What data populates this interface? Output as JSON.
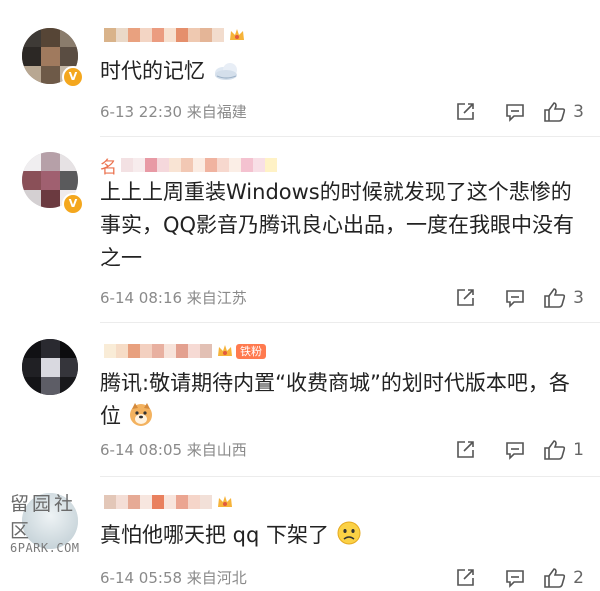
{
  "comments": [
    {
      "username_prefix": "",
      "text": "时代的记忆",
      "emoji": "cloud-emoji",
      "meta": "6-13 22:30 来自福建",
      "likes": "3",
      "verified": true,
      "fan_badge": ""
    },
    {
      "username_prefix": "名",
      "text": "上上上周重装Windows的时候就发现了这个悲惨的事实，QQ影音乃腾讯良心出品，一度在我眼中没有之一",
      "emoji": "",
      "meta": "6-14 08:16 来自江苏",
      "likes": "3",
      "verified": true,
      "fan_badge": ""
    },
    {
      "username_prefix": "",
      "text": "腾讯:敬请期待内置“收费商城”的划时代版本吧，各位",
      "emoji": "dog-emoji",
      "meta": "6-14 08:05 来自山西",
      "likes": "1",
      "verified": false,
      "fan_badge": "铁粉"
    },
    {
      "username_prefix": "",
      "text": "真怕他哪天把 qq 下架了",
      "emoji": "worried-face-emoji",
      "meta": "6-14 05:58 来自河北",
      "likes": "2",
      "verified": false,
      "fan_badge": ""
    }
  ],
  "watermark": {
    "cn": "留园社区",
    "en": "6PARK.COM"
  },
  "colors": {
    "username": "#eb7350",
    "meta": "#8a8a8a",
    "verified": "#f4a71e",
    "fan_badge": "#ff7a4f"
  }
}
